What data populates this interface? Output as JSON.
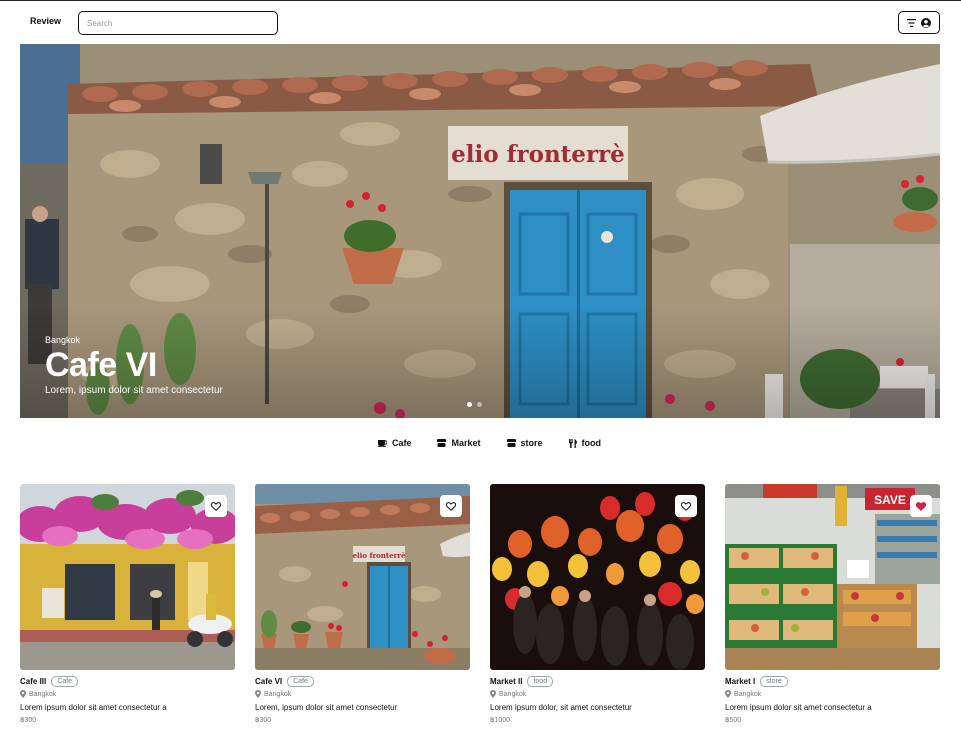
{
  "header": {
    "brand": "Review",
    "search_placeholder": "Search"
  },
  "icons": {
    "filter": "filter-lines-icon",
    "user": "user-circle-icon",
    "location": "map-pin-icon",
    "favorite": "heart-icon"
  },
  "hero": {
    "city": "Bangkok",
    "title": "Cafe VI",
    "description": "Lorem, ipsum dolor sit amet consectetur",
    "sign_text": "elio fronterrè"
  },
  "categories": [
    {
      "label": "Cafe",
      "icon": "coffee-cup-icon"
    },
    {
      "label": "Market",
      "icon": "market-stall-icon"
    },
    {
      "label": "store",
      "icon": "store-icon"
    },
    {
      "label": "food",
      "icon": "fork-knife-icon"
    }
  ],
  "cards": [
    {
      "title": "Cafe III",
      "tag": "Cafe",
      "location": "Bangkok",
      "description": "Lorem ipsum dolor sit amet consectetur a",
      "price": "฿300",
      "favorited": false
    },
    {
      "title": "Cafe VI",
      "tag": "Cafe",
      "location": "Bangkok",
      "description": "Lorem, ipsum dolor sit amet consectetur",
      "price": "฿300",
      "favorited": false,
      "sign_text": "elio fronterrè"
    },
    {
      "title": "Market II",
      "tag": "food",
      "location": "Bangkok",
      "description": "Lorem ipsum dolor, sit amet consectetur",
      "price": "฿1000",
      "favorited": false
    },
    {
      "title": "Market I",
      "tag": "store",
      "location": "Bangkok",
      "description": "Lorem ipsum dolor sit amet consectetur a",
      "price": "฿500",
      "favorited": true,
      "sign_text": "SAVE"
    }
  ],
  "colors": {
    "favorite_active": "#d6204a",
    "door_blue": "#2d8fc4"
  }
}
